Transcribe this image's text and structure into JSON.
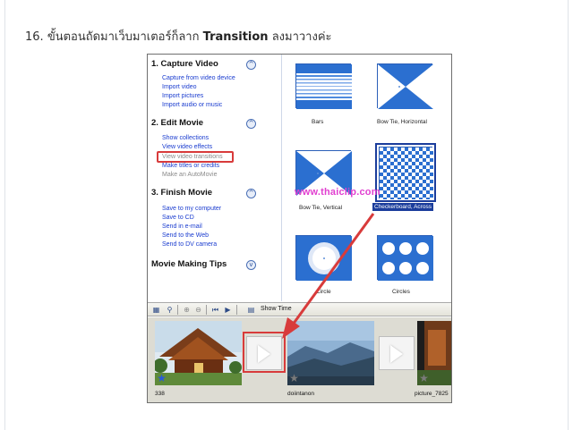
{
  "heading": {
    "number": "16.",
    "text_before": "ขั้นตอนถัดมาเว็บมาเตอร์ก็ลาก",
    "bold_word": "Transition",
    "text_after": "ลงมาวางค่ะ"
  },
  "task_pane": {
    "sections": [
      {
        "title": "1. Capture Video",
        "links": [
          "Capture from video device",
          "Import video",
          "Import pictures",
          "Import audio or music"
        ]
      },
      {
        "title": "2. Edit Movie",
        "links": [
          "Show collections",
          "View video effects",
          "View video transitions",
          "Make titles or credits",
          "Make an AutoMovie"
        ]
      },
      {
        "title": "3. Finish Movie",
        "links": [
          "Save to my computer",
          "Save to CD",
          "Send in e-mail",
          "Send to the Web",
          "Send to DV camera"
        ]
      },
      {
        "title": "Movie Making Tips",
        "links": []
      }
    ],
    "collapse_icon": "chevron-up-icon",
    "expand_icon": "chevron-down-icon"
  },
  "transitions": [
    {
      "name": "Bars",
      "selected": false
    },
    {
      "name": "Bow Tie, Horizontal",
      "selected": false
    },
    {
      "name": "Bow Tie, Vertical",
      "selected": false
    },
    {
      "name": "Checkerboard, Across",
      "selected": true
    },
    {
      "name": "Circle",
      "selected": false
    },
    {
      "name": "Circles",
      "selected": false
    }
  ],
  "watermark": "www.thaiclip.com",
  "storyboard_toolbar": {
    "show_timeline_label": "Show Time"
  },
  "storyboard": {
    "clips": [
      {
        "label": "338"
      },
      {
        "label": "doiintanon"
      },
      {
        "label": "picture_7825"
      }
    ]
  },
  "colors": {
    "link": "#1a3ccf",
    "highlight": "#d83b3b",
    "selection": "#1b3d9c",
    "tile_blue": "#2b6fd0",
    "watermark": "#e13fd0"
  }
}
